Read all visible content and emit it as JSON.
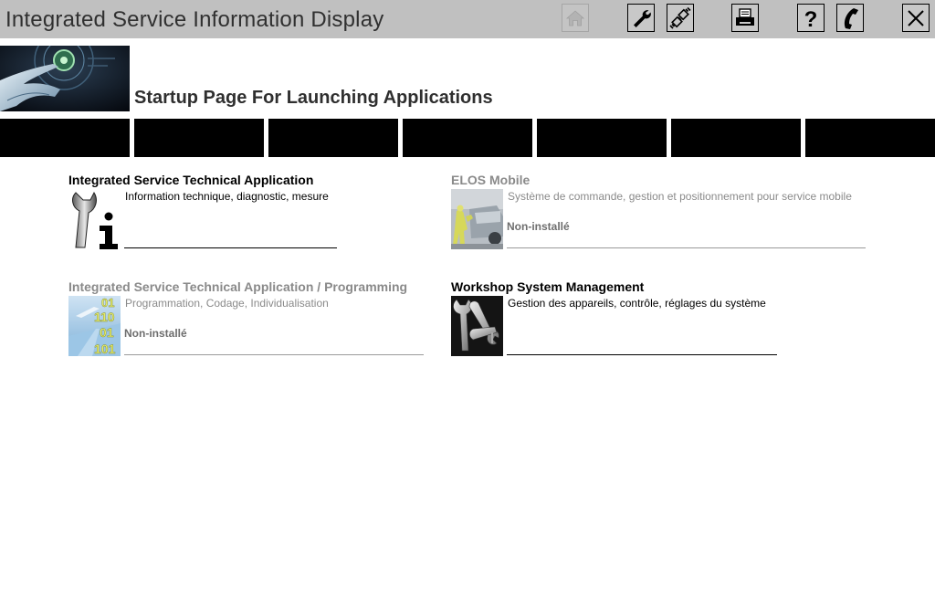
{
  "window": {
    "title": "Integrated Service Information Display"
  },
  "toolbar": {
    "buttons": [
      {
        "name": "home-button",
        "icon": "home-icon",
        "enabled": false
      },
      {
        "name": "settings-button",
        "icon": "wrench-icon",
        "enabled": true
      },
      {
        "name": "connection-button",
        "icon": "plug-icon",
        "enabled": true
      },
      {
        "name": "print-button",
        "icon": "printer-icon",
        "enabled": true
      },
      {
        "name": "help-button",
        "icon": "question-icon",
        "enabled": true
      },
      {
        "name": "contact-button",
        "icon": "phone-icon",
        "enabled": true
      },
      {
        "name": "close-button",
        "icon": "close-icon",
        "enabled": true
      }
    ]
  },
  "header": {
    "page_title": "Startup Page For Launching Applications",
    "banner_icon": "hand-touch-image"
  },
  "nav": {
    "tab_count": 7,
    "tab_color": "#000000"
  },
  "apps": [
    {
      "title": "Integrated Service Technical Application",
      "description": "Information technique, diagnostic, mesure",
      "status": "",
      "installed": true,
      "icon": "wrench-info-icon"
    },
    {
      "title": "ELOS Mobile",
      "description": "Système de commande, gestion et positionnement pour service mobile",
      "status": "Non-installé",
      "installed": false,
      "icon": "mobile-service-photo"
    },
    {
      "title": "Integrated Service Technical Application / Programming",
      "description": "Programmation, Codage, Individualisation",
      "status": "Non-installé",
      "installed": false,
      "icon": "binary-code-image"
    },
    {
      "title": "Workshop System Management",
      "description": "Gestion des appareils, contrôle, réglages du système",
      "status": "",
      "installed": true,
      "icon": "wrenches-icon"
    }
  ],
  "colors": {
    "titlebar_bg": "#c0c0c0",
    "nav_tab": "#000000",
    "disabled_text": "#8a8a8a",
    "status_text": "#6e6e6e"
  }
}
